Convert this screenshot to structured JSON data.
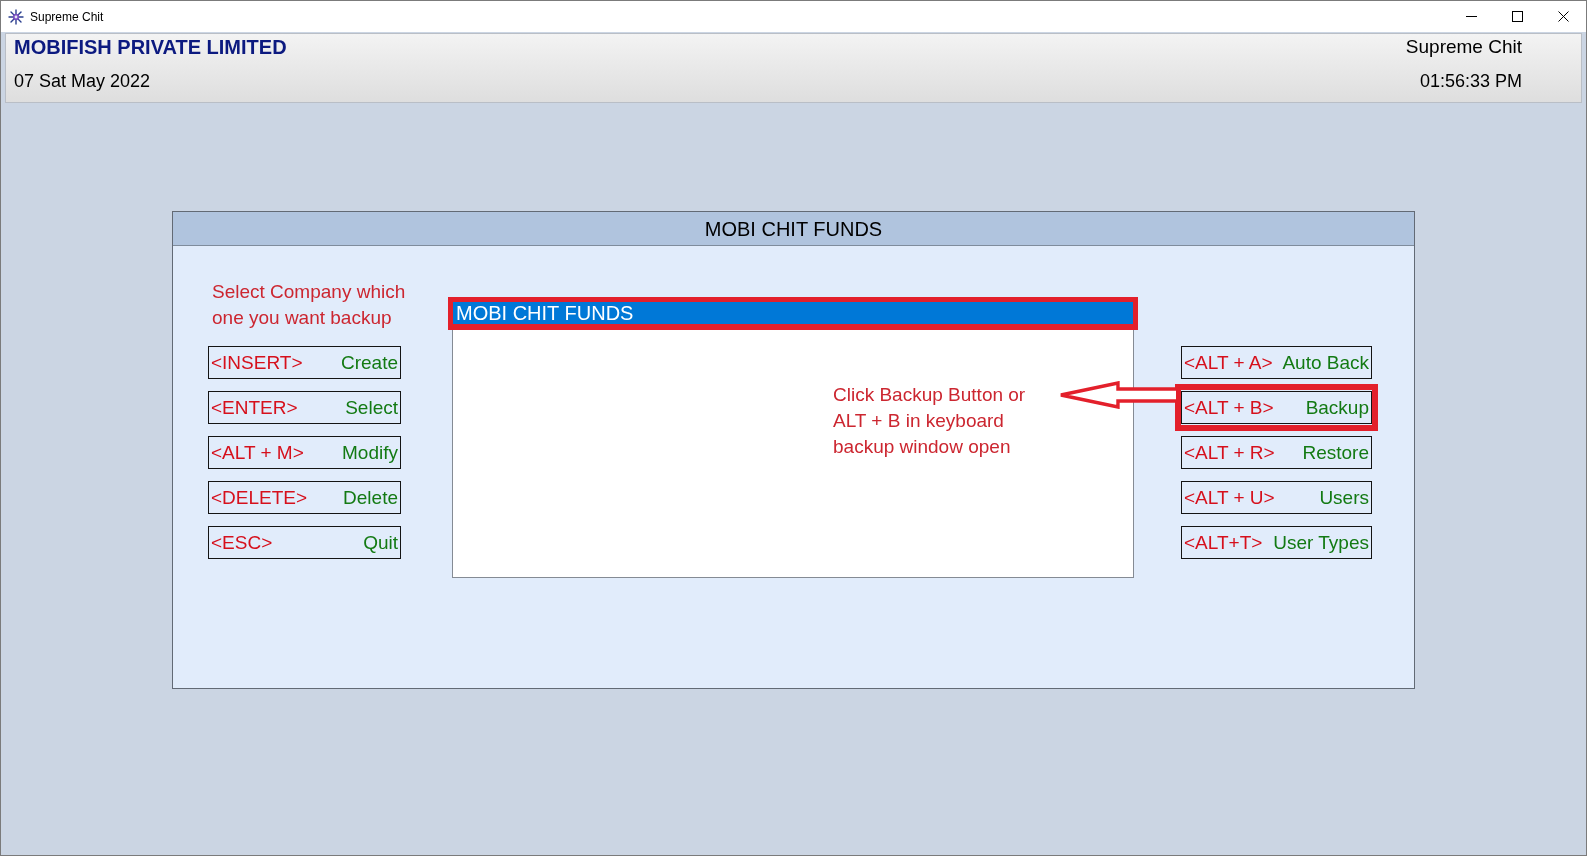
{
  "window": {
    "title": "Supreme Chit"
  },
  "header": {
    "company": "MOBIFISH PRIVATE LIMITED",
    "date": "07 Sat May 2022",
    "app_name": "Supreme Chit",
    "time": "01:56:33 PM"
  },
  "dialog": {
    "title": "MOBI CHIT FUNDS",
    "left_buttons": [
      {
        "key": "<INSERT>",
        "action": "Create",
        "highlighted": false
      },
      {
        "key": "<ENTER>",
        "action": "Select",
        "highlighted": false
      },
      {
        "key": "<ALT + M>",
        "action": "Modify",
        "highlighted": false
      },
      {
        "key": "<DELETE>",
        "action": "Delete",
        "highlighted": false
      },
      {
        "key": "<ESC>",
        "action": "Quit",
        "highlighted": false
      }
    ],
    "company_list": [
      {
        "name": "MOBI CHIT FUNDS",
        "selected": true,
        "highlighted": true
      }
    ],
    "right_buttons": [
      {
        "key": "<ALT + A>",
        "action": "Auto Back",
        "highlighted": false
      },
      {
        "key": "<ALT + B>",
        "action": "Backup",
        "highlighted": true
      },
      {
        "key": "<ALT + R>",
        "action": "Restore",
        "highlighted": false
      },
      {
        "key": "<ALT + U>",
        "action": "Users",
        "highlighted": false
      },
      {
        "key": "<ALT+T>",
        "action": "User Types",
        "highlighted": false
      }
    ]
  },
  "annotations": [
    {
      "kind": "note",
      "lines": [
        "Select Company which",
        "one you want backup"
      ]
    },
    {
      "kind": "arrow_note",
      "lines": [
        "Click Backup Button or",
        "ALT + B in keyboard",
        "backup window open"
      ]
    }
  ]
}
